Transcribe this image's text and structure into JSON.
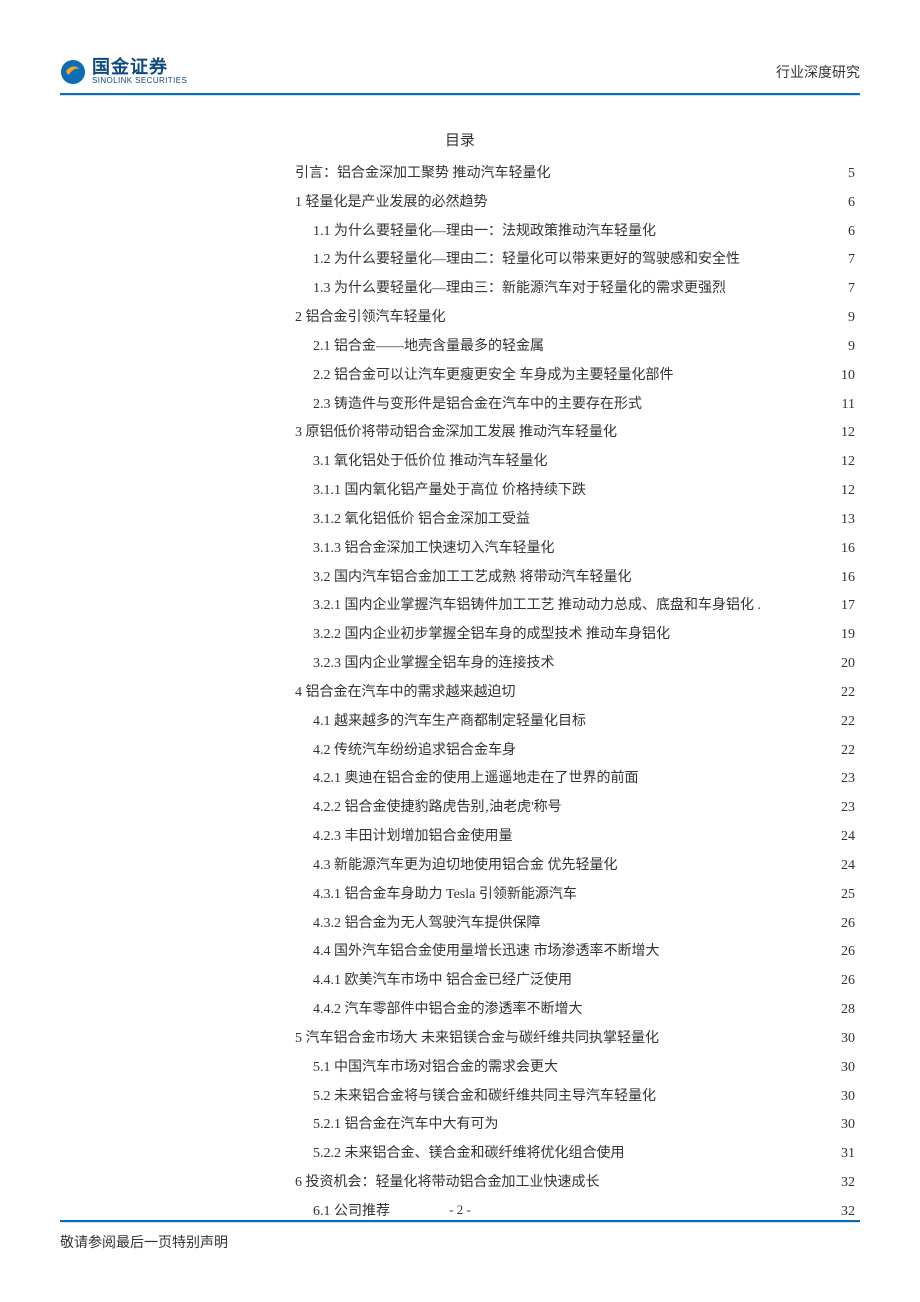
{
  "header": {
    "logo_cn": "国金证券",
    "logo_en": "SINOLINK SECURITIES",
    "right": "行业深度研究"
  },
  "toc_title": "目录",
  "toc": [
    {
      "lvl": 1,
      "label": "引言：铝合金深加工聚势 推动汽车轻量化",
      "page": "5"
    },
    {
      "lvl": 1,
      "label": "1 轻量化是产业发展的必然趋势",
      "page": "6"
    },
    {
      "lvl": 2,
      "label": "1.1 为什么要轻量化—理由一：法规政策推动汽车轻量化",
      "page": "6"
    },
    {
      "lvl": 2,
      "label": "1.2 为什么要轻量化—理由二：轻量化可以带来更好的驾驶感和安全性",
      "page": "7"
    },
    {
      "lvl": 2,
      "label": "1.3 为什么要轻量化—理由三：新能源汽车对于轻量化的需求更强烈",
      "page": "7"
    },
    {
      "lvl": 1,
      "label": "2 铝合金引领汽车轻量化",
      "page": "9"
    },
    {
      "lvl": 2,
      "label": "2.1 铝合金——地壳含量最多的轻金属",
      "page": "9"
    },
    {
      "lvl": 2,
      "label": "2.2 铝合金可以让汽车更瘦更安全 车身成为主要轻量化部件",
      "page": "10"
    },
    {
      "lvl": 2,
      "label": "2.3 铸造件与变形件是铝合金在汽车中的主要存在形式",
      "page": "11"
    },
    {
      "lvl": 1,
      "label": "3 原铝低价将带动铝合金深加工发展 推动汽车轻量化",
      "page": "12"
    },
    {
      "lvl": 2,
      "label": "3.1 氧化铝处于低价位 推动汽车轻量化",
      "page": "12"
    },
    {
      "lvl": 3,
      "label": "3.1.1 国内氧化铝产量处于高位 价格持续下跌",
      "page": "12"
    },
    {
      "lvl": 3,
      "label": "3.1.2 氧化铝低价 铝合金深加工受益",
      "page": "13"
    },
    {
      "lvl": 3,
      "label": "3.1.3 铝合金深加工快速切入汽车轻量化",
      "page": "16"
    },
    {
      "lvl": 2,
      "label": "3.2 国内汽车铝合金加工工艺成熟 将带动汽车轻量化",
      "page": "16"
    },
    {
      "lvl": 3,
      "label": "3.2.1 国内企业掌握汽车铝铸件加工工艺 推动动力总成、底盘和车身铝化 .",
      "page": "17"
    },
    {
      "lvl": 3,
      "label": "3.2.2 国内企业初步掌握全铝车身的成型技术 推动车身铝化",
      "page": "19"
    },
    {
      "lvl": 3,
      "label": "3.2.3 国内企业掌握全铝车身的连接技术",
      "page": "20"
    },
    {
      "lvl": 1,
      "label": "4 铝合金在汽车中的需求越来越迫切",
      "page": "22"
    },
    {
      "lvl": 2,
      "label": "4.1 越来越多的汽车生产商都制定轻量化目标",
      "page": "22"
    },
    {
      "lvl": 2,
      "label": "4.2 传统汽车纷纷追求铝合金车身",
      "page": "22"
    },
    {
      "lvl": 3,
      "label": "4.2.1 奥迪在铝合金的使用上遥遥地走在了世界的前面",
      "page": "23"
    },
    {
      "lvl": 3,
      "label": "4.2.2 铝合金使捷豹路虎告别‚油老虎'称号",
      "page": "23"
    },
    {
      "lvl": 3,
      "label": "4.2.3 丰田计划增加铝合金使用量",
      "page": "24"
    },
    {
      "lvl": 2,
      "label": "4.3 新能源汽车更为迫切地使用铝合金 优先轻量化",
      "page": "24"
    },
    {
      "lvl": 3,
      "label": "4.3.1 铝合金车身助力 Tesla 引领新能源汽车",
      "page": "25"
    },
    {
      "lvl": 3,
      "label": "4.3.2 铝合金为无人驾驶汽车提供保障",
      "page": "26"
    },
    {
      "lvl": 2,
      "label": "4.4 国外汽车铝合金使用量增长迅速 市场渗透率不断增大",
      "page": "26"
    },
    {
      "lvl": 3,
      "label": "4.4.1 欧美汽车市场中 铝合金已经广泛使用",
      "page": "26"
    },
    {
      "lvl": 3,
      "label": "4.4.2 汽车零部件中铝合金的渗透率不断增大",
      "page": "28"
    },
    {
      "lvl": 1,
      "label": "5 汽车铝合金市场大 未来铝镁合金与碳纤维共同执掌轻量化",
      "page": "30"
    },
    {
      "lvl": 2,
      "label": "5.1 中国汽车市场对铝合金的需求会更大",
      "page": "30"
    },
    {
      "lvl": 2,
      "label": "5.2 未来铝合金将与镁合金和碳纤维共同主导汽车轻量化",
      "page": "30"
    },
    {
      "lvl": 3,
      "label": "5.2.1 铝合金在汽车中大有可为",
      "page": "30"
    },
    {
      "lvl": 3,
      "label": "5.2.2 未来铝合金、镁合金和碳纤维将优化组合使用",
      "page": "31"
    },
    {
      "lvl": 1,
      "label": "6 投资机会：轻量化将带动铝合金加工业快速成长",
      "page": "32"
    },
    {
      "lvl": 2,
      "label": "6.1 公司推荐",
      "page": "32"
    }
  ],
  "footer": {
    "page_num": "- 2 -",
    "disclaimer": "敬请参阅最后一页特别声明"
  }
}
